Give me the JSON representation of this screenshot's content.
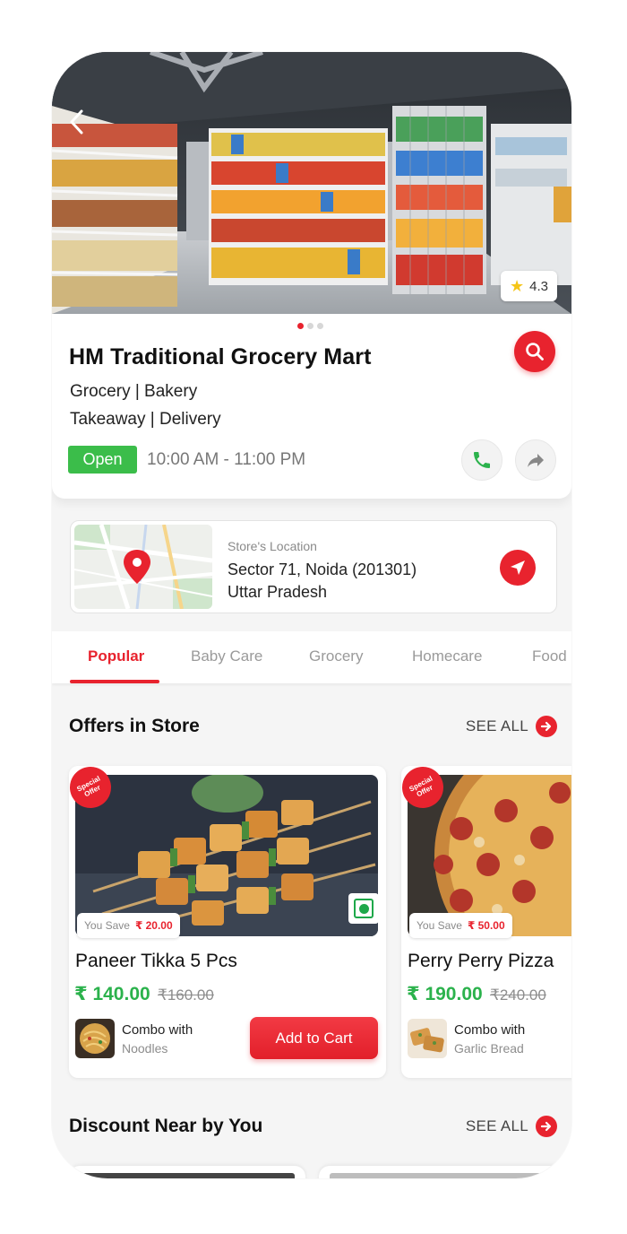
{
  "hero": {
    "rating": "4.3",
    "carousel_pages": 3,
    "carousel_active_index": 0
  },
  "store": {
    "name": "HM Traditional Grocery Mart",
    "categories_line1": "Grocery | Bakery",
    "categories_line2": "Takeaway | Delivery",
    "status": "Open",
    "hours": "10:00 AM - 11:00 PM"
  },
  "location": {
    "caption": "Store's Location",
    "address_line1": "Sector 71, Noida (201301)",
    "address_line2": "Uttar Pradesh"
  },
  "tabs": [
    {
      "label": "Popular",
      "active": true
    },
    {
      "label": "Baby Care",
      "active": false
    },
    {
      "label": "Grocery",
      "active": false
    },
    {
      "label": "Homecare",
      "active": false
    },
    {
      "label": "Food",
      "active": false
    }
  ],
  "offers": {
    "title": "Offers in Store",
    "see_all": "SEE ALL",
    "items": [
      {
        "badge": "Special Offer",
        "save_label": "You Save",
        "save_amount": "₹ 20.00",
        "name": "Paneer Tikka 5 Pcs",
        "price": "₹ 140.00",
        "old_price": "₹160.00",
        "combo_title": "Combo with",
        "combo_item": "Noodles",
        "cta": "Add to Cart",
        "veg": true
      },
      {
        "badge": "Special Offer",
        "save_label": "You Save",
        "save_amount": "₹ 50.00",
        "name": "Perry Perry Pizza",
        "price": "₹ 190.00",
        "old_price": "₹240.00",
        "combo_title": "Combo with",
        "combo_item": "Garlic Bread"
      }
    ]
  },
  "discount": {
    "title": "Discount Near by You",
    "see_all": "SEE ALL"
  },
  "colors": {
    "accent": "#e8232e",
    "open_green": "#3bbd4a",
    "price_green": "#2bb24c"
  }
}
